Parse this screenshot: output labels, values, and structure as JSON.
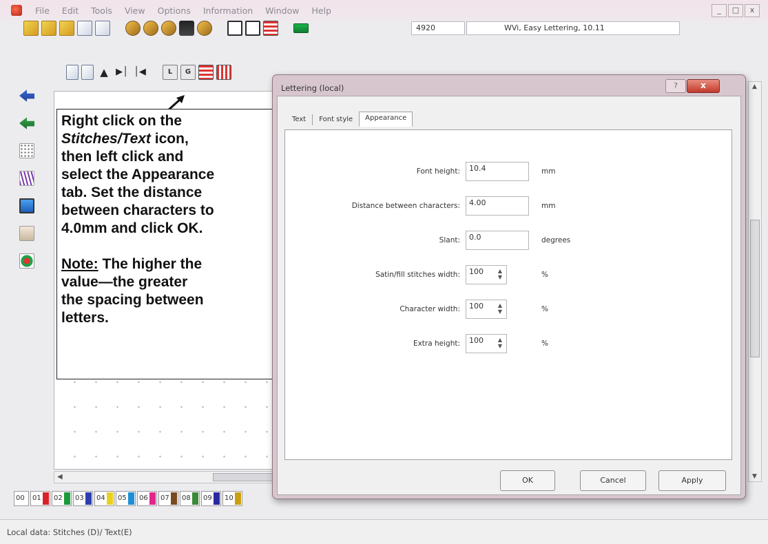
{
  "menu": [
    "File",
    "Edit",
    "Tools",
    "View",
    "Options",
    "Information",
    "Window",
    "Help"
  ],
  "window_controls": [
    "_",
    "□",
    "x"
  ],
  "toolbar": {
    "count": "4920",
    "machine": "WVi, Easy Lettering, 10.11"
  },
  "icons_row2": [
    "L",
    "G"
  ],
  "instruction": {
    "line1": "Right click on the",
    "line2_italic": "Stitches/Text",
    "line2_rest": " icon,",
    "line3": "then left click and",
    "line4": "select the Appearance",
    "line5": "tab. Set the distance",
    "line6": "between characters to",
    "line7": "4.0mm and click OK.",
    "note_label": "Note:",
    "note_rest": " The higher the",
    "line9": "value—the greater",
    "line10": "the spacing between",
    "line11": "letters."
  },
  "palette": {
    "labels": [
      "00",
      "01",
      "02",
      "03",
      "04",
      "05",
      "06",
      "07",
      "08",
      "09",
      "10"
    ],
    "colors": [
      "#ffffff",
      "#d8232a",
      "#1a9a3a",
      "#2b3fae",
      "#e8d21f",
      "#1c8fd6",
      "#e0268a",
      "#7a4a20",
      "#3a8a3a",
      "#2a2aa0",
      "#c8a010"
    ]
  },
  "status": "Local data: Stitches (D)/ Text(E)",
  "dialog": {
    "title": "Lettering (local)",
    "help": "?",
    "close": "x",
    "tabs": [
      "Text",
      "Font style",
      "Appearance"
    ],
    "fields": [
      {
        "label": "Font height:",
        "value": "10.4",
        "unit": "mm"
      },
      {
        "label": "Distance between characters:",
        "value": "4.00",
        "unit": "mm"
      },
      {
        "label": "Slant:",
        "value": "0.0",
        "unit": "degrees"
      },
      {
        "label": "Satin/fill stitches width:",
        "value": "100",
        "unit": "%"
      },
      {
        "label": "Character width:",
        "value": "100",
        "unit": "%"
      },
      {
        "label": "Extra height:",
        "value": "100",
        "unit": "%"
      }
    ],
    "buttons": {
      "ok": "OK",
      "cancel": "Cancel",
      "apply": "Apply"
    }
  }
}
